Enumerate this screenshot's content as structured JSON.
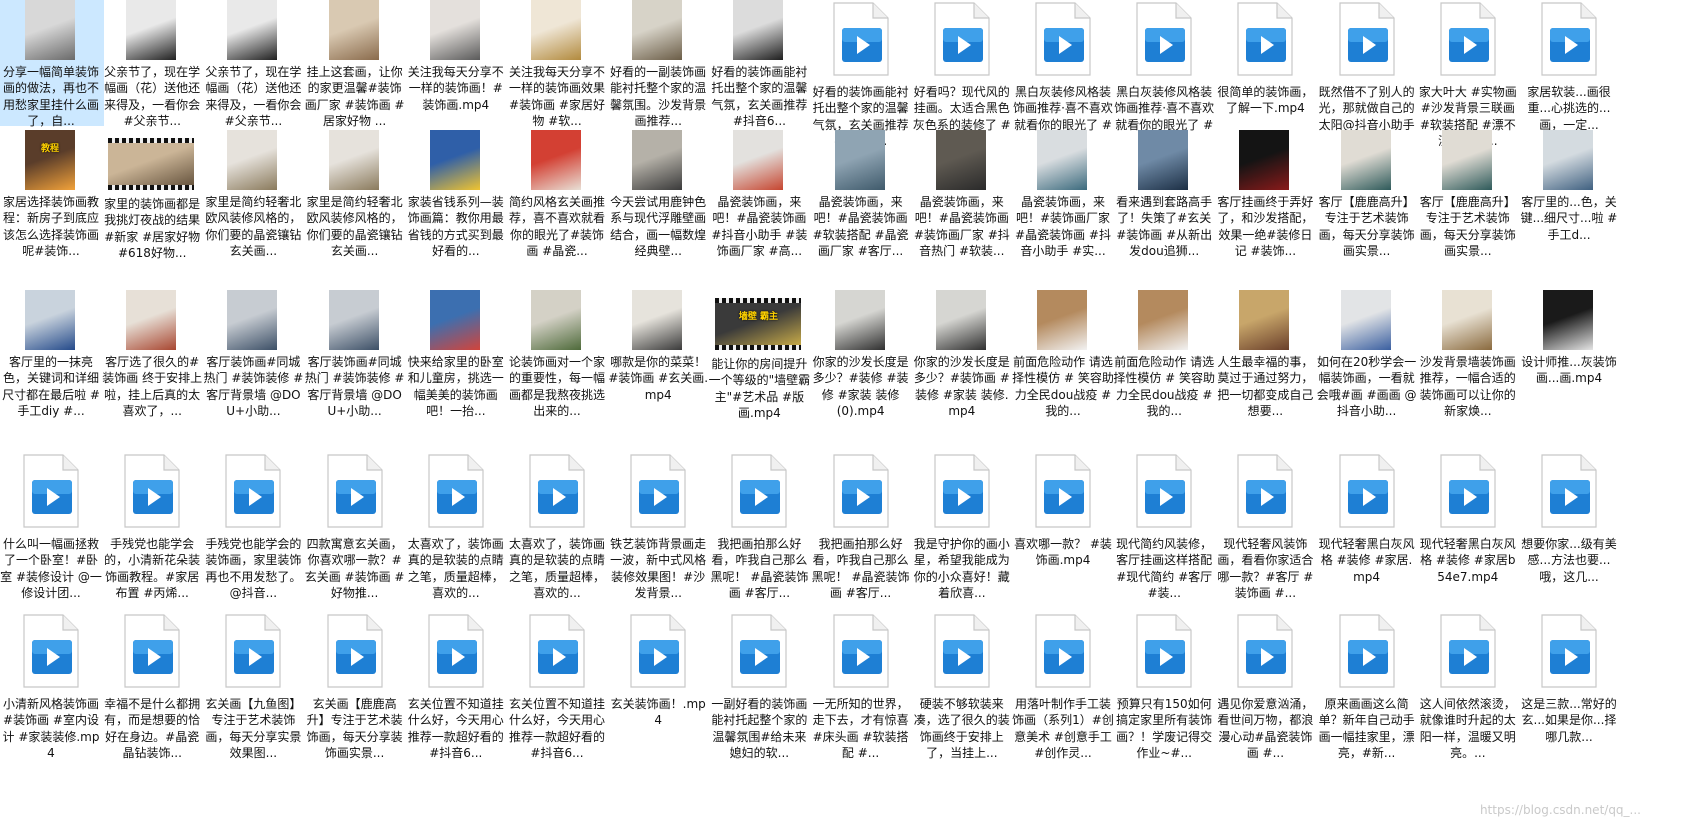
{
  "rows": [
    [
      {
        "caption": "分享一幅简单装饰画的做法，再也不用愁家里挂什么画了，自...",
        "thumb": "photo",
        "palette": [
          "#d8d8d8",
          "#6a6a6a"
        ],
        "selected": true
      },
      {
        "caption": "父亲节了，现在学幅画（花）送他还来得及，一看你会#父亲节...",
        "thumb": "photo",
        "palette": [
          "#e9e9e9",
          "#202020"
        ]
      },
      {
        "caption": "父亲节了，现在学幅画（花）送他还来得及，一看你会#父亲节...",
        "thumb": "photo",
        "palette": [
          "#e9e9e9",
          "#202020"
        ]
      },
      {
        "caption": "挂上这套画，让你的家更温馨#装饰画厂家 #装饰画 #居家好物 ...",
        "thumb": "photo",
        "palette": [
          "#d9c9b2",
          "#8a6b4c"
        ]
      },
      {
        "caption": "关注我每天分享不一样的装饰画！#装饰画.mp4",
        "thumb": "photo",
        "palette": [
          "#e4e0dc",
          "#5a5a5a"
        ]
      },
      {
        "caption": "关注我每天分享不一样的装饰画效果 #装饰画 #家居好物 #软...",
        "thumb": "photo",
        "palette": [
          "#efe6d6",
          "#b28a3d"
        ]
      },
      {
        "caption": "好看的一副装饰画能衬托整个家的温馨氛围。沙发背景画推荐...",
        "thumb": "photo",
        "palette": [
          "#d7d3c8",
          "#6b5d47"
        ]
      },
      {
        "caption": "好看的装饰画能衬托出整个家的温馨气氛，玄关画推荐#抖音6...",
        "thumb": "photo",
        "palette": [
          "#dcdcdc",
          "#1e1e1e"
        ]
      },
      {
        "caption": "好看的装饰画能衬托出整个家的温馨气氛，玄关画推荐#抖音6...",
        "thumb": "icon"
      },
      {
        "caption": "好看吗？现代风的挂画。太适合黑色灰色系的装修了 #装修 #...",
        "thumb": "icon"
      },
      {
        "caption": "黑白灰装修风格装饰画推荐·喜不喜欢就看你的眼光了 #设计师...",
        "thumb": "icon"
      },
      {
        "caption": "黑白灰装修风格装饰画推荐·喜不喜欢就看你的眼光了 #设计师...",
        "thumb": "icon"
      },
      {
        "caption": "很简单的装饰画，了解一下.mp4",
        "thumb": "icon"
      },
      {
        "caption": "既然借不了别人的光，那就做自己的太阳@抖音小助手 #床头...",
        "thumb": "icon"
      },
      {
        "caption": "家大叶大 #实物画 #沙发背景三联画 #软装搭配 #漂不漂亮你们...",
        "thumb": "icon"
      },
      {
        "caption": "家居软装...画很重...心挑选的...画，一定...",
        "thumb": "icon"
      }
    ],
    [
      {
        "caption": "家居选择装饰画教程：新房子到底应该怎么选择装饰画呢#装饰...",
        "thumb": "photo",
        "palette": [
          "#5a3d2a",
          "#f2a23a"
        ],
        "overlay": "教程"
      },
      {
        "caption": "家里的装饰画都是我挑灯夜战的结果#新家 #居家好物 #618好物...",
        "thumb": "landscape",
        "palette": [
          "#cbb597",
          "#5c4a35"
        ]
      },
      {
        "caption": "家里是简约轻奢北欧风装修风格的，你们要的晶瓷镶钻玄关画...",
        "thumb": "photo",
        "palette": [
          "#e6e2dc",
          "#8a7a5c"
        ]
      },
      {
        "caption": "家里是简约轻奢北欧风装修风格的，你们要的晶瓷镶钻玄关画...",
        "thumb": "photo",
        "palette": [
          "#e6e2dc",
          "#8a7a5c"
        ]
      },
      {
        "caption": "家装省钱系列—装饰画篇：教你用最省钱的方式买到最好看的...",
        "thumb": "photo",
        "palette": [
          "#2f5fa8",
          "#f0c430"
        ]
      },
      {
        "caption": "简约风格玄关画推荐，喜不喜欢就看你的眼光了#装饰画 #晶瓷...",
        "thumb": "photo",
        "palette": [
          "#d34033",
          "#e8e0d6"
        ]
      },
      {
        "caption": "今天尝试用鹿钟色系与现代浮雕壁画结合，画一幅数煌经典壁...",
        "thumb": "photo",
        "palette": [
          "#b5b1a8",
          "#3a3a3a"
        ]
      },
      {
        "caption": "晶瓷装饰画，来吧！#晶瓷装饰画 #抖音小助手 #装饰画厂家 #高...",
        "thumb": "photo",
        "palette": [
          "#e3e1de",
          "#c6452f"
        ]
      },
      {
        "caption": "晶瓷装饰画，来吧！#晶瓷装饰画 #软装搭配 #晶瓷画厂家 #客厅...",
        "thumb": "photo",
        "palette": [
          "#8fa4b3",
          "#3f5a6b"
        ]
      },
      {
        "caption": "晶瓷装饰画，来吧！#晶瓷装饰画 #装饰画厂家 #抖音热门 #软装...",
        "thumb": "photo",
        "palette": [
          "#5f5a52",
          "#2a2a2a"
        ]
      },
      {
        "caption": "晶瓷装饰画，来吧！#装饰画厂家 #晶瓷装饰画 #抖音小助手 #实...",
        "thumb": "photo",
        "palette": [
          "#d9dde0",
          "#3b6a7d"
        ]
      },
      {
        "caption": "看来遇到套路高手了！失策了#玄关 #装饰画 #从新出发dou追狮...",
        "thumb": "photo",
        "palette": [
          "#6f8aa6",
          "#1c2f45"
        ]
      },
      {
        "caption": "客厅挂画终于弄好了，和沙发搭配，效果一绝#装修日记 #装饰...",
        "thumb": "photo",
        "palette": [
          "#141414",
          "#8a1a1a"
        ]
      },
      {
        "caption": "客厅【鹿鹿高升】专注于艺术装饰画，每天分享装饰画实景...",
        "thumb": "photo",
        "palette": [
          "#e0dcd4",
          "#2e5a5a"
        ]
      },
      {
        "caption": "客厅【鹿鹿高升】专注于艺术装饰画，每天分享装饰画实景...",
        "thumb": "photo",
        "palette": [
          "#e0dcd4",
          "#2e5a5a"
        ]
      },
      {
        "caption": "客厅里的...色，关键...细尺寸...啦 #手工d...",
        "thumb": "photo",
        "palette": [
          "#d4dbe0",
          "#3f6080"
        ]
      }
    ],
    [
      {
        "caption": "客厅里的一抹亮色，关键词和详细尺寸都在最后啦 #手工diy #...",
        "thumb": "photo",
        "palette": [
          "#c9d3dd",
          "#244a8a"
        ]
      },
      {
        "caption": "客厅选了很久的#装饰画 终于安排上啦，挂上后真的太喜欢了，...",
        "thumb": "photo",
        "palette": [
          "#e7e0d7",
          "#a84630"
        ]
      },
      {
        "caption": "客厅装饰画#同城热门 #装饰装修 #客厅背景墙 @DOU+小助...",
        "thumb": "photo",
        "palette": [
          "#c7ccd2",
          "#3c4f66"
        ]
      },
      {
        "caption": "客厅装饰画#同城热门 #装饰装修 #客厅背景墙 @DOU+小助...",
        "thumb": "photo",
        "palette": [
          "#c7ccd2",
          "#3c4f66"
        ]
      },
      {
        "caption": "快来给家里的卧室和儿童房，挑选一幅美美的装饰画吧！一抬...",
        "thumb": "photo",
        "palette": [
          "#3c6fb0",
          "#d2443b"
        ]
      },
      {
        "caption": "论装饰画对一个家的重要性，每一幅画都是我熬夜挑选出来的...",
        "thumb": "photo",
        "palette": [
          "#d4d1c6",
          "#4e6a3a"
        ]
      },
      {
        "caption": "哪款是你的菜菜！#装饰画 #玄关画.mp4",
        "thumb": "photo",
        "palette": [
          "#e6e3dc",
          "#3a3a3a"
        ]
      },
      {
        "caption": "能让你的房间提升一个等级的\"墙壁霸主\"#艺术品 #版画.mp4",
        "thumb": "landscape",
        "palette": [
          "#3a3a3a",
          "#d8b84a"
        ],
        "overlay": "墙壁 霸主"
      },
      {
        "caption": "你家的沙发长度是多少？#装修 #装修 #家装 装修 (0).mp4",
        "thumb": "photo",
        "palette": [
          "#d6d6d2",
          "#2f2f2f"
        ]
      },
      {
        "caption": "你家的沙发长度是多少？#装饰画 #装修 #家装 装修.mp4",
        "thumb": "photo",
        "palette": [
          "#d6d6d2",
          "#2f2f2f"
        ]
      },
      {
        "caption": "前面危险动作 请选择性模仿 # 笑容助力全民dou战疫 #我的...",
        "thumb": "photo",
        "palette": [
          "#b48a5e",
          "#f2f2f2"
        ]
      },
      {
        "caption": "前面危险动作 请选择性模仿 # 笑容助力全民dou战疫 #我的...",
        "thumb": "photo",
        "palette": [
          "#b48a5e",
          "#f2f2f2"
        ]
      },
      {
        "caption": "人生最幸福的事，莫过于通过努力，把一切都变成自己想要...",
        "thumb": "photo",
        "palette": [
          "#c8a66a",
          "#6a3f2a"
        ]
      },
      {
        "caption": "如何在20秒学会一幅装饰画，一看就会哦#画 #画画 @抖音小助...",
        "thumb": "photo",
        "palette": [
          "#e2e4e6",
          "#3a5fa0"
        ]
      },
      {
        "caption": "沙发背景墙装饰画推荐，一幅合适的装饰画可以让你的新家焕...",
        "thumb": "photo",
        "palette": [
          "#e8e1d3",
          "#8a6a3e"
        ]
      },
      {
        "caption": "设计师推...灰装饰画...画.mp4",
        "thumb": "photo",
        "palette": [
          "#1a1a1a",
          "#e5e5e5"
        ]
      }
    ],
    [
      {
        "caption": "什么叫一幅画拯救了一个卧室！#卧室 #装修设计 @一修设计团...",
        "thumb": "icon"
      },
      {
        "caption": "手残党也能学会的，小清新花朵装饰画教程。#家居布置 #丙烯...",
        "thumb": "icon"
      },
      {
        "caption": "手残党也能学会的装饰画，家里装饰再也不用发愁了。 @抖音...",
        "thumb": "icon"
      },
      {
        "caption": "四款寓意玄关画，你喜欢哪一款？#玄关画 #装饰画 #好物推...",
        "thumb": "icon"
      },
      {
        "caption": "太喜欢了，装饰画真的是软装的点睛之笔，质量超棒，喜欢的...",
        "thumb": "icon"
      },
      {
        "caption": "太喜欢了，装饰画真的是软装的点睛之笔，质量超棒，喜欢的...",
        "thumb": "icon"
      },
      {
        "caption": "铁艺装饰背景画走一波，新中式风格装修效果图！#沙发背景...",
        "thumb": "icon"
      },
      {
        "caption": "我把画拍那么好看，咋我自己那么黑呢！ #晶瓷装饰画 #客厅...",
        "thumb": "icon"
      },
      {
        "caption": "我把画拍那么好看，咋我自己那么黑呢！ #晶瓷装饰画 #客厅...",
        "thumb": "icon"
      },
      {
        "caption": "我是守护你的画小星，希望我能成为你的小众喜好！藏着欣喜...",
        "thumb": "icon"
      },
      {
        "caption": "喜欢哪一款？ #装饰画.mp4",
        "thumb": "icon"
      },
      {
        "caption": "现代简约风装修，客厅挂画这样搭配 #现代简约 #客厅 #装...",
        "thumb": "icon"
      },
      {
        "caption": "现代轻奢风装饰画，看看你家适合哪一款？#客厅 #装饰画 #...",
        "thumb": "icon"
      },
      {
        "caption": "现代轻奢黑白灰风格 #装修 #家居.mp4",
        "thumb": "icon"
      },
      {
        "caption": "现代轻奢黑白灰风格 #装修 #家居b54e7.mp4",
        "thumb": "icon"
      },
      {
        "caption": "想要你家...级有美感...方法也要...哦，这几...",
        "thumb": "icon"
      }
    ],
    [
      {
        "caption": "小清新风格装饰画#装饰画 #室内设计 #家装装修.mp4",
        "thumb": "icon"
      },
      {
        "caption": "幸福不是什么都拥有，而是想要的恰好在身边。#晶瓷晶钻装饰...",
        "thumb": "icon"
      },
      {
        "caption": "玄关画【九鱼图】专注于艺术装饰画，每天分享实景效果图...",
        "thumb": "icon"
      },
      {
        "caption": "玄关画【鹿鹿高升】专注于艺术装饰画，每天分享装饰画实景...",
        "thumb": "icon"
      },
      {
        "caption": "玄关位置不知道挂什么好，今天用心推荐一款超好看的#抖音6...",
        "thumb": "icon"
      },
      {
        "caption": "玄关位置不知道挂什么好，今天用心推荐一款超好看的#抖音6...",
        "thumb": "icon"
      },
      {
        "caption": "玄关装饰画！.mp4",
        "thumb": "icon"
      },
      {
        "caption": "一副好看的装饰画能衬托起整个家的温馨氛围#给未来媳妇的软...",
        "thumb": "icon"
      },
      {
        "caption": "一无所知的世界，走下去，才有惊喜#床头画 #软装搭配 #...",
        "thumb": "icon"
      },
      {
        "caption": "硬装不够软装来凑，选了很久的装饰画终于安排上了，当挂上...",
        "thumb": "icon"
      },
      {
        "caption": "用落叶制作手工装饰画（系列1）#创意美术 #创意手工 #创作灵...",
        "thumb": "icon"
      },
      {
        "caption": "预算只有150如何搞定家里所有装饰画？！学废记得交作业~#...",
        "thumb": "icon"
      },
      {
        "caption": "遇见你爱意汹涌，看世间万物，都浪漫心动#晶瓷装饰画 #...",
        "thumb": "icon"
      },
      {
        "caption": "原来画画这么简单？新年自己动手画一幅挂家里，漂亮，#新...",
        "thumb": "icon"
      },
      {
        "caption": "这人间依然滚烫，就像谁时升起的太阳一样，温暖又明亮。...",
        "thumb": "icon"
      },
      {
        "caption": "这是三款...常好的玄...如果是你...择哪几款...",
        "thumb": "icon"
      }
    ]
  ],
  "watermark": "https://blog.csdn.net/qq_...",
  "colors": {
    "selected_bg": "#cce8ff",
    "icon_blue": "#1e7fd4",
    "play": "#ffffff"
  }
}
